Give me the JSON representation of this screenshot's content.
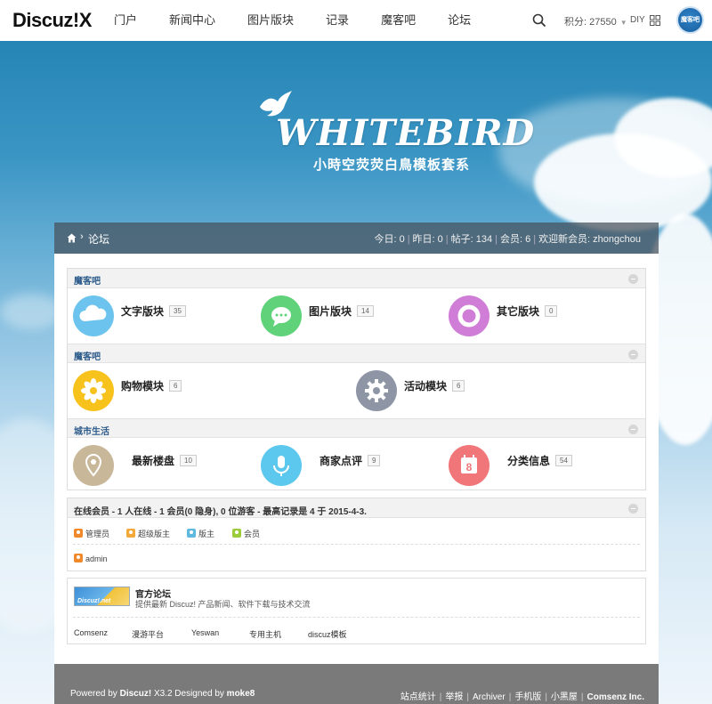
{
  "header": {
    "logo": "Discuz!X",
    "nav": [
      "门户",
      "新闻中心",
      "图片版块",
      "记录",
      "魔客吧",
      "论坛"
    ],
    "credits": "积分: 27550",
    "diy": "DIY",
    "avatar_text": "魔客吧"
  },
  "banner": {
    "title": "WHITEBIRD",
    "subtitle": "小時空荧荧白鳥模板套系"
  },
  "breadcrumb": {
    "current": "论坛",
    "separator": "›"
  },
  "stats": {
    "today": "今日: 0",
    "yesterday": "昨日: 0",
    "posts": "帖子: 134",
    "members": "会员: 6",
    "newest": "欢迎新会员: zhongchou"
  },
  "categories": [
    {
      "title": "魔客吧",
      "forums": [
        {
          "name": "文字版块",
          "count": "35",
          "color": "#6cc4ee",
          "icon": "cloud-icon"
        },
        {
          "name": "图片版块",
          "count": "14",
          "color": "#5fd27a",
          "icon": "chat-bubble-icon"
        },
        {
          "name": "其它版块",
          "count": "0",
          "color": "#cf7dd6",
          "icon": "ring-icon"
        }
      ]
    },
    {
      "title": "魔客吧",
      "forums": [
        {
          "name": "购物模块",
          "count": "6",
          "color": "#f7c21c",
          "icon": "flower-icon"
        },
        {
          "name": "活动模块",
          "count": "6",
          "color": "#8e96a6",
          "icon": "gear-icon"
        }
      ]
    },
    {
      "title": "城市生活",
      "forums": [
        {
          "name": "最新楼盘",
          "count": "10",
          "color": "#c9b79a",
          "icon": "location-pin-icon"
        },
        {
          "name": "商家点评",
          "count": "9",
          "color": "#5cc8ee",
          "icon": "microphone-icon"
        },
        {
          "name": "分类信息",
          "count": "54",
          "color": "#f0767a",
          "icon": "calendar-icon"
        }
      ]
    }
  ],
  "online": {
    "title": "在线会员 - 1 人在线 - 1 会员(0 隐身), 0 位游客 - 最高记录是 4 于 2015-4-3.",
    "legend": [
      {
        "label": "管理员",
        "color": "#f0892a"
      },
      {
        "label": "超级版主",
        "color": "#f2a93a"
      },
      {
        "label": "版主",
        "color": "#5fb8e0"
      },
      {
        "label": "会员",
        "color": "#9ccc3c"
      }
    ],
    "users": [
      {
        "name": "admin",
        "color": "#f0892a"
      }
    ]
  },
  "links": {
    "logo_text": "Discuz!.net",
    "title": "官方论坛",
    "desc": "提供最新 Discuz! 产品新闻、软件下载与技术交流",
    "friends": [
      "Comsenz",
      "漫游平台",
      "Yeswan",
      "专用主机",
      "discuz模板"
    ]
  },
  "footer": {
    "powered": "Powered by",
    "product": "Discuz!",
    "version": "X3.2 Designed by",
    "designer": "moke8",
    "links": [
      "站点统计",
      "举报",
      "Archiver",
      "手机版",
      "小黑屋"
    ],
    "company": "Comsenz Inc."
  }
}
